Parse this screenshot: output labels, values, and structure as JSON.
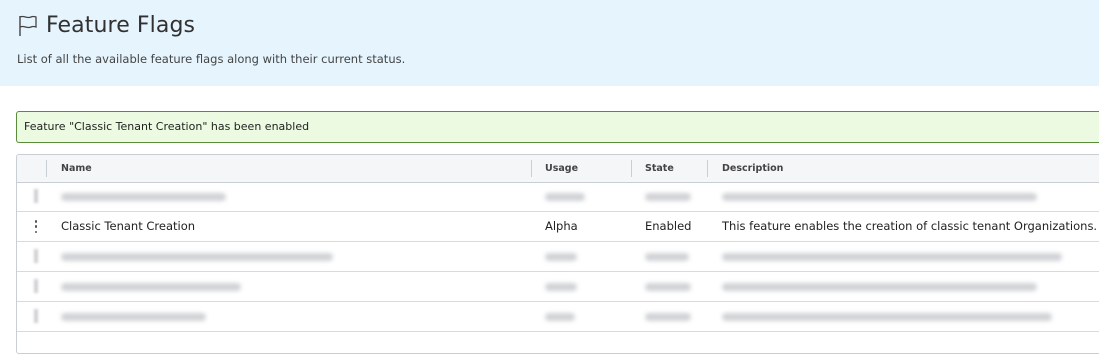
{
  "header": {
    "title": "Feature Flags",
    "subtitle": "List of all the available feature flags along with their current status.",
    "icon": "flag-icon",
    "background": "#e5f4fd"
  },
  "alert": {
    "message": "Feature \"Classic Tenant Creation\" has been enabled",
    "background": "#ebfae1",
    "border_color": "#5a8d3a"
  },
  "grid": {
    "columns": {
      "name": "Name",
      "usage": "Usage",
      "state": "State",
      "description": "Description"
    },
    "rows": [
      {
        "blurred": true
      },
      {
        "blurred": false,
        "name": "Classic Tenant Creation",
        "usage": "Alpha",
        "state": "Enabled",
        "description": "This feature enables the creation of classic tenant Organizations.",
        "action_icon": "kebab-menu-icon"
      },
      {
        "blurred": true
      },
      {
        "blurred": true
      },
      {
        "blurred": true
      }
    ]
  }
}
